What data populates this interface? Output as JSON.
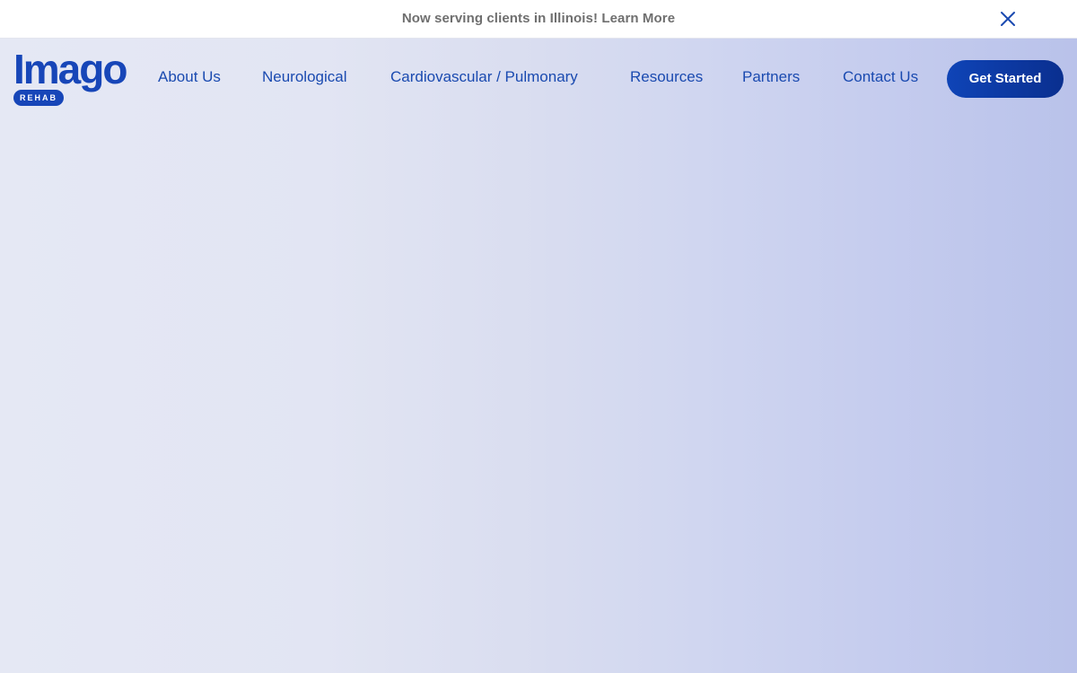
{
  "announcement": {
    "text": "Now serving clients in Illinois! Learn More",
    "close_icon": "close-icon"
  },
  "brand": {
    "logo_word": "Imago",
    "logo_badge": "REHAB",
    "primary_color": "#1746b8"
  },
  "nav": {
    "items": [
      {
        "label": "About Us"
      },
      {
        "label": "Neurological"
      },
      {
        "label": "Cardiovascular / Pulmonary"
      },
      {
        "label": "Resources"
      },
      {
        "label": "Partners"
      },
      {
        "label": "Contact Us"
      }
    ],
    "cta_label": "Get Started"
  }
}
